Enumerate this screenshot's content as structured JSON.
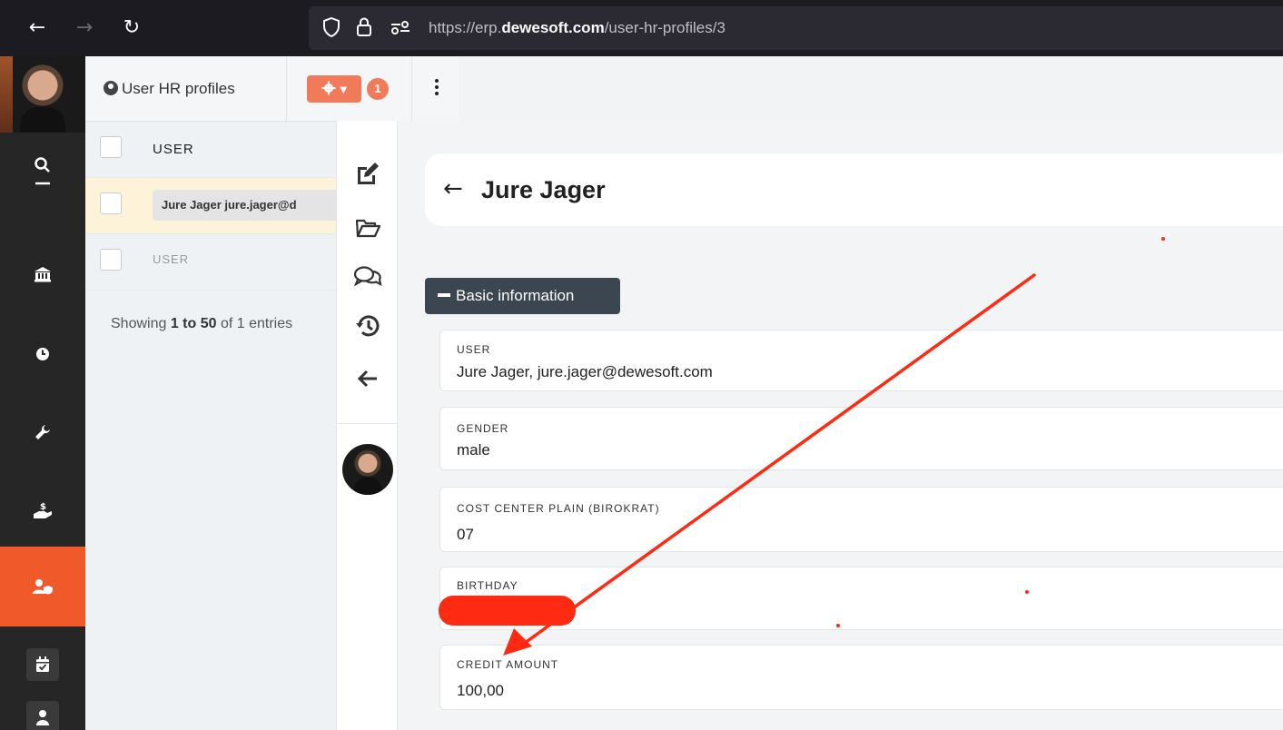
{
  "browser": {
    "url_prefix": "https://erp.",
    "url_domain": "dewesoft.com",
    "url_path": "/user-hr-profiles/3",
    "back_icon": "arrow-left-icon",
    "forward_icon": "arrow-right-icon",
    "reload_icon": "reload-icon",
    "shield_icon": "shield-icon",
    "lock_icon": "lock-icon",
    "permissions_icon": "permissions-icon"
  },
  "sidebar": {
    "items": [
      {
        "icon": "search-icon"
      },
      {
        "icon": "bank-icon"
      },
      {
        "icon": "clock-icon"
      },
      {
        "icon": "wrench-icon"
      },
      {
        "icon": "money-hand-icon"
      },
      {
        "icon": "user-shield-icon",
        "active": true
      },
      {
        "icon": "calendar-check-icon"
      },
      {
        "icon": "person-icon"
      }
    ],
    "active_color": "#f05a2a"
  },
  "list": {
    "toolbar_title": "User HR profiles",
    "badge_count": "1",
    "column_header": "USER",
    "rows": [
      {
        "user": "Jure Jager jure.jager@d"
      }
    ],
    "filter_placeholder": "USER",
    "showing_prefix": "Showing ",
    "showing_range": "1 to 50",
    "showing_suffix": " of 1 entries"
  },
  "actions": {
    "icons": [
      "edit-icon",
      "folder-open-icon",
      "comments-icon",
      "history-icon",
      "back-arrow-icon"
    ]
  },
  "detail": {
    "title": "Jure Jager",
    "section_label": "Basic information",
    "fields": [
      {
        "label": "USER",
        "value": "Jure Jager, jure.jager@dewesoft.com"
      },
      {
        "label": "GENDER",
        "value": "male"
      },
      {
        "label": "COST CENTER PLAIN (BIROKRAT)",
        "value": "07"
      },
      {
        "label": "BIRTHDAY",
        "value": ""
      },
      {
        "label": "CREDIT AMOUNT",
        "value": "100,00"
      }
    ]
  },
  "colors": {
    "accent": "#f05a2a",
    "annotation": "#ff2a12",
    "section": "#3b4650"
  }
}
